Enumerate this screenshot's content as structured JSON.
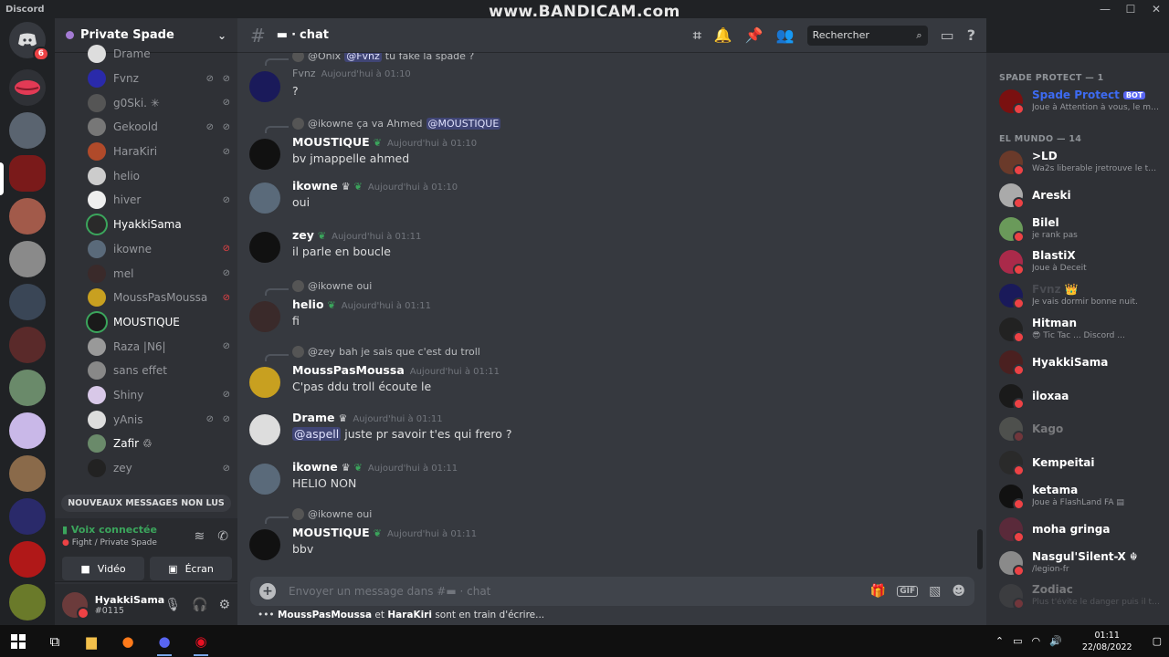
{
  "window": {
    "app_name": "Discord",
    "watermark": "www.BANDICAM.com",
    "controls": [
      "—",
      "☐",
      "✕"
    ]
  },
  "rail": {
    "home_badge": "6",
    "server_count": 14
  },
  "server": {
    "name": "Private Spade"
  },
  "voice_users": [
    {
      "name": "Drame",
      "icons": []
    },
    {
      "name": "Fvnz",
      "icons": [
        "mic-muted",
        "deafened"
      ]
    },
    {
      "name": "g0Ski. ✳",
      "icons": [
        "mic-muted"
      ]
    },
    {
      "name": "Gekoold",
      "icons": [
        "mic-muted",
        "deafened"
      ]
    },
    {
      "name": "HaraKiri",
      "icons": [
        "mic-muted"
      ]
    },
    {
      "name": "helio",
      "icons": []
    },
    {
      "name": "hiver",
      "icons": [
        "mic-muted"
      ]
    },
    {
      "name": "HyakkiSama",
      "icons": [],
      "bright": true,
      "speaking": true
    },
    {
      "name": "ikowne",
      "icons": [
        "mic-muted-red"
      ]
    },
    {
      "name": "mel",
      "icons": [
        "mic-muted"
      ]
    },
    {
      "name": "MoussPasMoussa",
      "icons": [
        "mic-muted-red"
      ]
    },
    {
      "name": "MOUSTIQUE",
      "icons": [],
      "bright": true,
      "speaking": true
    },
    {
      "name": "Raza |N6|",
      "icons": [
        "mic-muted"
      ]
    },
    {
      "name": "sans effet",
      "icons": []
    },
    {
      "name": "Shiny",
      "icons": [
        "mic-muted"
      ]
    },
    {
      "name": "yAnis",
      "icons": [
        "mic-muted",
        "deafened"
      ]
    },
    {
      "name": "Zafir ♲",
      "icons": [],
      "bright": true
    },
    {
      "name": "zey",
      "icons": [
        "mic-muted"
      ]
    }
  ],
  "sidebar": {
    "new_messages": "NOUVEAUX MESSAGES NON LUS",
    "voice_connected": "Voix connectée",
    "voice_location": "Fight / Private Spade",
    "video_label": "Vidéo",
    "screen_label": "Écran"
  },
  "user": {
    "name": "HyakkiSama",
    "tag": "#0115"
  },
  "channel": {
    "name": "chat",
    "search_placeholder": "Rechercher"
  },
  "messages": [
    {
      "reply": {
        "author": "@Onix",
        "mention": "@Fvnz",
        "text": "tu fake la spade ?"
      },
      "author": "Fvnz",
      "time": "Aujourd'hui à 01:10",
      "text": "?",
      "dim_author": true
    },
    {
      "reply": {
        "author": "@ikowne",
        "text": "ça va Ahmed",
        "mention": "@MOUSTIQUE"
      },
      "author": "MOUSTIQUE",
      "leaf": true,
      "time": "Aujourd'hui à 01:10",
      "text": "bv jmappelle ahmed"
    },
    {
      "author": "ikowne",
      "crown": true,
      "leaf": true,
      "time": "Aujourd'hui à 01:10",
      "text": "oui"
    },
    {
      "author": "zey",
      "leaf": true,
      "time": "Aujourd'hui à 01:11",
      "text": "il parle en boucle"
    },
    {
      "reply": {
        "author": "@ikowne",
        "text": "oui"
      },
      "author": "helio",
      "leaf": true,
      "time": "Aujourd'hui à 01:11",
      "text": "fi"
    },
    {
      "reply": {
        "author": "@zey",
        "text": "bah je sais que c'est du troll"
      },
      "author": "MoussPasMoussa",
      "time": "Aujourd'hui à 01:11",
      "text": "C'pas ddu troll écoute le"
    },
    {
      "author": "Drame",
      "crown": true,
      "time": "Aujourd'hui à 01:11",
      "mention": "@aspell",
      "text": "juste pr savoir t'es qui frero ?"
    },
    {
      "author": "ikowne",
      "crown": true,
      "leaf": true,
      "time": "Aujourd'hui à 01:11",
      "text": "HELIO NON"
    },
    {
      "reply": {
        "author": "@ikowne",
        "text": "oui"
      },
      "author": "MOUSTIQUE",
      "leaf": true,
      "time": "Aujourd'hui à 01:11",
      "text": "bbv"
    }
  ],
  "composer": {
    "placeholder_prefix": "Envoyer un message dans #",
    "placeholder_channel": "· chat",
    "gif": "GIF"
  },
  "typing": {
    "user1": "MoussPasMoussa",
    "sep": "et",
    "user2": "HaraKiri",
    "suffix": "sont en train d'écrire..."
  },
  "member_groups": [
    {
      "title": "SPADE PROTECT — 1",
      "members": [
        {
          "name": "Spade Protect",
          "bot": "BOT",
          "status": "Joue à Attention à vous, le mo...",
          "blue": true
        }
      ]
    },
    {
      "title": "EL MUNDO — 14",
      "members": [
        {
          "name": ">LD",
          "status": "Wa2s liberable jretrouve le ter..."
        },
        {
          "name": "Areski",
          "status": ""
        },
        {
          "name": "Bilel",
          "status": "je rank pas"
        },
        {
          "name": "BlastiX",
          "status": "Joue à Deceit"
        },
        {
          "name": "Fvnz 👑",
          "status": "Je vais dormir bonne nuit.",
          "dim": true
        },
        {
          "name": "Hitman",
          "status": "😎 Tic Tac ... Discord ..."
        },
        {
          "name": "HyakkiSama",
          "status": ""
        },
        {
          "name": "iloxaa",
          "status": ""
        },
        {
          "name": "Kago",
          "status": "",
          "offline": true
        },
        {
          "name": "Kempeitai",
          "status": ""
        },
        {
          "name": "ketama",
          "status": "Joue à FlashLand FA ▤"
        },
        {
          "name": "moha gringa",
          "status": ""
        },
        {
          "name": "Nasgul'Silent-X ☬",
          "status": "/legion-fr"
        },
        {
          "name": "Zodiac",
          "status": "Plus t'évite le danger puis il te ...",
          "offline": true
        }
      ]
    }
  ],
  "taskbar": {
    "time": "01:11",
    "date": "22/08/2022"
  }
}
